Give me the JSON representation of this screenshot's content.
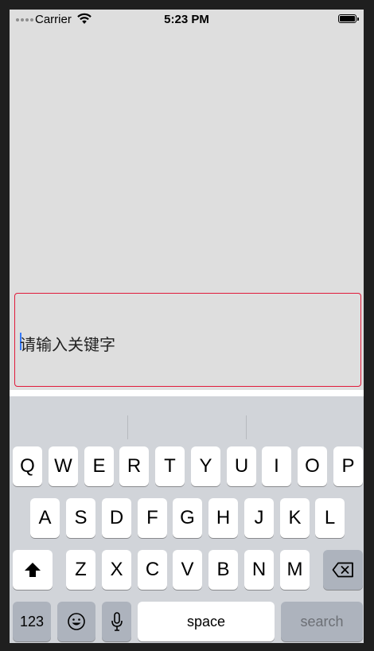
{
  "status_bar": {
    "carrier": "Carrier",
    "time": "5:23 PM",
    "icons": [
      "signal-dots-icon",
      "wifi-icon",
      "battery-icon"
    ]
  },
  "search_field": {
    "placeholder": "请输入关键字",
    "border_color": "#e11a3a",
    "caret_color": "#3478f6"
  },
  "keyboard": {
    "row1": [
      "Q",
      "W",
      "E",
      "R",
      "T",
      "Y",
      "U",
      "I",
      "O",
      "P"
    ],
    "row2": [
      "A",
      "S",
      "D",
      "F",
      "G",
      "H",
      "J",
      "K",
      "L"
    ],
    "row3": [
      "Z",
      "X",
      "C",
      "V",
      "B",
      "N",
      "M"
    ],
    "bottom": {
      "numbers_label": "123",
      "space_label": "space",
      "return_label": "search"
    },
    "icons": [
      "shift-icon",
      "delete-icon",
      "emoji-icon",
      "microphone-icon"
    ]
  }
}
